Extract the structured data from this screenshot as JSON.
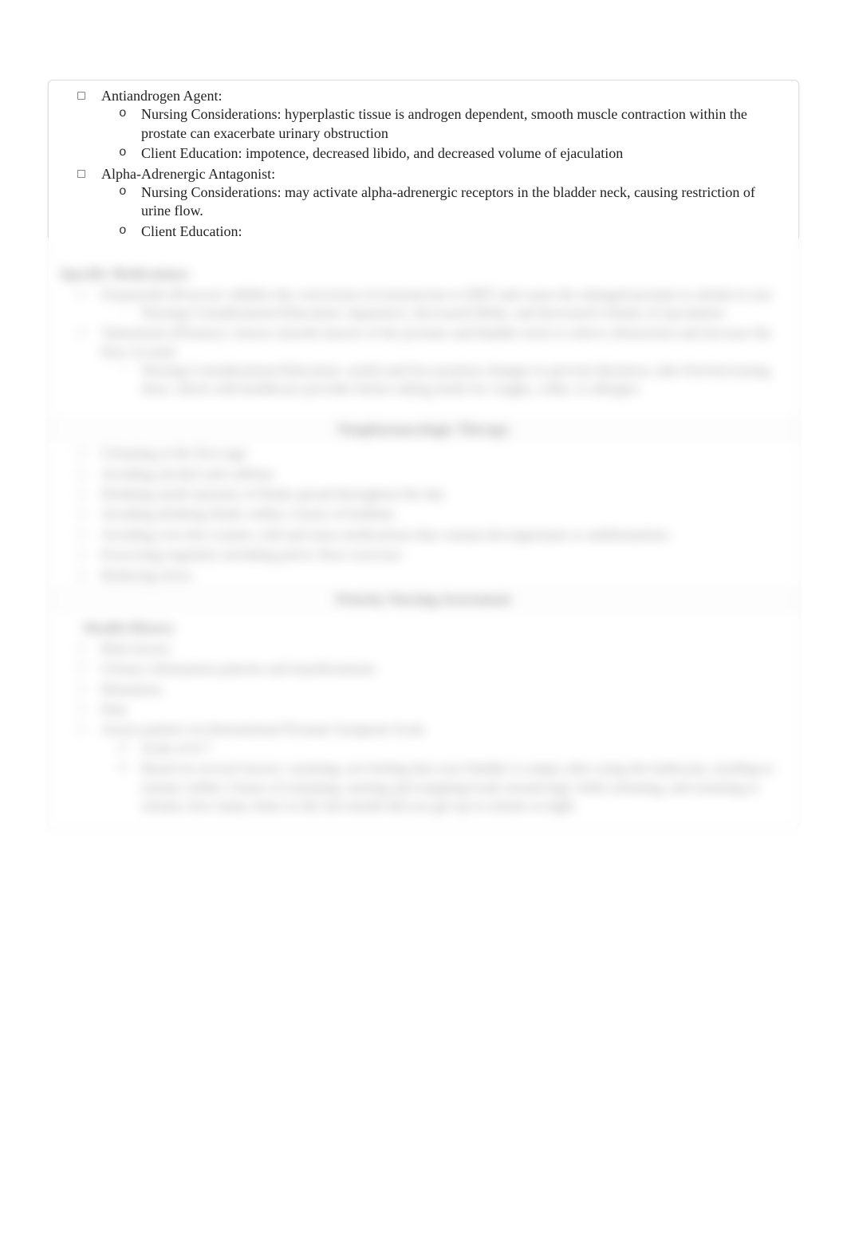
{
  "visible": {
    "items": [
      {
        "label": "Antiandrogen Agent:",
        "sub": [
          {
            "text": "Nursing Considerations: hyperplastic tissue is androgen dependent, smooth muscle contraction within the prostate can exacerbate urinary obstruction"
          },
          {
            "text": "Client Education: impotence, decreased libido, and decreased volume of ejaculation"
          }
        ]
      },
      {
        "label": "Alpha-Adrenergic Antagonist:",
        "sub": [
          {
            "text": "Nursing Considerations: may activate alpha-adrenergic receptors in the bladder neck, causing restriction of urine flow."
          },
          {
            "text": "Client Education:"
          }
        ]
      }
    ]
  },
  "blurred": {
    "specific_med_heading": "Specific Medications:",
    "specific_med": [
      {
        "label": "Finasteride (Proscar): inhibits the conversion of testosterone to DHT and cause the enlarged prostate to shrink in size",
        "sub": [
          {
            "text": "Nursing Considerations/Education: impotence, decreased libido, and decreased volume of ejaculation"
          }
        ]
      },
      {
        "label": "Tamsulosin (Flomax): relaxes smooth muscle of the prostate and bladder neck to relieve obstruction and increase the flow of urine",
        "sub": [
          {
            "text": "Nursing Considerations/Education: useful and less position changes to prevent dizziness; take first/increasing dose; check with healthcare provider before taking meds for coughs, colds, or allergies"
          }
        ]
      }
    ],
    "nonpharm_heading": "Nonpharmacologic Therapy",
    "nonpharm_items": [
      "Urinating at the first urge",
      "Avoiding alcohol and caffeine",
      "Drinking small amounts of fluids spread throughout the day",
      "Avoiding drinking fluids within 2 hours of bedtime",
      "Avoiding over-the-counter cold and sinus medications that contain decongestants or antihistamines",
      "Exercising regularly including pelvic floor exercises",
      "Reducing stress"
    ],
    "assess_heading": "Priority Nursing Assessment",
    "health_history_heading": "Health History",
    "health_history_items": [
      {
        "label": "Risk factors"
      },
      {
        "label": "Urinary elimination patterns and manifestations"
      },
      {
        "label": "Hematuria"
      },
      {
        "label": "Pain"
      },
      {
        "label": "Assess patient via International Prostate Symptom Scale",
        "sub": [
          {
            "text": "Scale of 0-7"
          },
          {
            "text": "Based on several factors: straining, not feeling that your bladder is empty after using the bathroom, needing to urinate within 2 hours of urinating, starting and stopping/weak stream/urge while urinating, and straining to urinate; how many times in the last month did you get up to urinate at night"
          }
        ]
      }
    ]
  }
}
